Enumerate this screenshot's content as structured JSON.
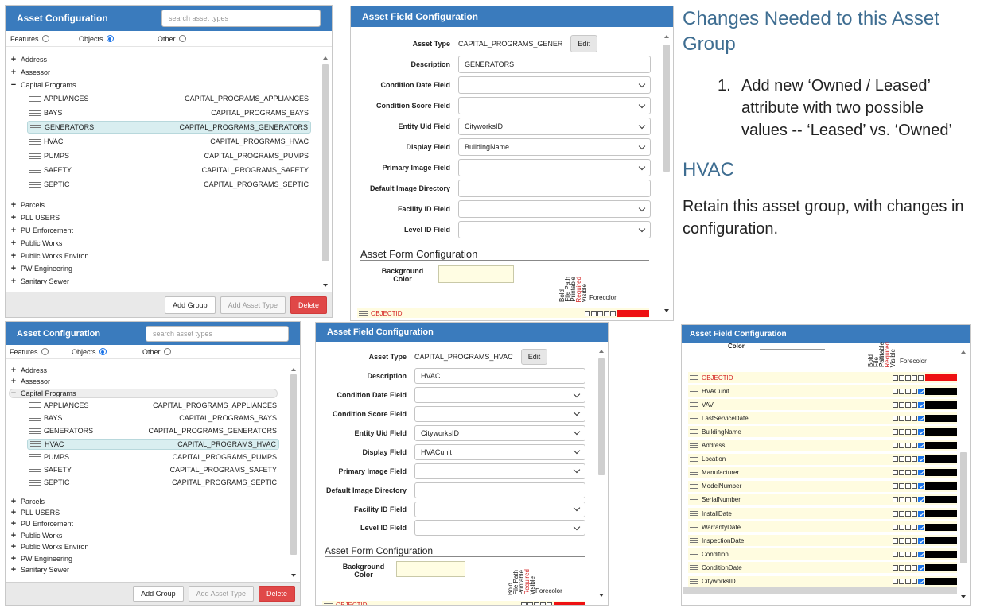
{
  "asset_config": {
    "title": "Asset Configuration",
    "search_placeholder": "search asset types",
    "radios": [
      {
        "label": "Features",
        "checked": false
      },
      {
        "label": "Objects",
        "checked": true
      },
      {
        "label": "Other",
        "checked": false
      }
    ],
    "top_nodes": [
      {
        "sign": "+",
        "label": "Address"
      },
      {
        "sign": "+",
        "label": "Assessor"
      },
      {
        "sign": "−",
        "label": "Capital Programs"
      }
    ],
    "leaves": [
      {
        "name": "APPLIANCES",
        "code": "CAPITAL_PROGRAMS_APPLIANCES"
      },
      {
        "name": "BAYS",
        "code": "CAPITAL_PROGRAMS_BAYS"
      },
      {
        "name": "GENERATORS",
        "code": "CAPITAL_PROGRAMS_GENERATORS"
      },
      {
        "name": "HVAC",
        "code": "CAPITAL_PROGRAMS_HVAC"
      },
      {
        "name": "PUMPS",
        "code": "CAPITAL_PROGRAMS_PUMPS"
      },
      {
        "name": "SAFETY",
        "code": "CAPITAL_PROGRAMS_SAFETY"
      },
      {
        "name": "SEPTIC",
        "code": "CAPITAL_PROGRAMS_SEPTIC"
      }
    ],
    "bottom_nodes": [
      {
        "sign": "+",
        "label": "Parcels"
      },
      {
        "sign": "+",
        "label": "PLL USERS"
      },
      {
        "sign": "+",
        "label": "PU Enforcement"
      },
      {
        "sign": "+",
        "label": "Public Works"
      },
      {
        "sign": "+",
        "label": "Public Works Environ"
      },
      {
        "sign": "+",
        "label": "PW Engineering"
      },
      {
        "sign": "+",
        "label": "Sanitary Sewer"
      }
    ],
    "buttons": {
      "add_group": "Add Group",
      "add_asset_type": "Add Asset Type",
      "delete": "Delete"
    }
  },
  "field_config_labels": {
    "title": "Asset Field Configuration",
    "asset_type": "Asset Type",
    "edit": "Edit",
    "description": "Description",
    "condition_date": "Condition Date Field",
    "condition_score": "Condition Score Field",
    "entity_uid": "Entity Uid Field",
    "display": "Display Field",
    "primary_image": "Primary Image Field",
    "default_image_dir": "Default Image Directory",
    "facility_id": "Facility ID Field",
    "level_id": "Level ID Field",
    "form_title": "Asset Form Configuration",
    "bg_color": "Background Color",
    "col_bold": "Bold",
    "col_filepath": "File Path",
    "col_printable": "Printable",
    "col_required": "Required",
    "col_visible": "Visible",
    "col_forecolor": "Forecolor",
    "partial_first_field": "OBJECTID"
  },
  "generators": {
    "selected": "GENERATORS",
    "asset_type_value": "CAPITAL_PROGRAMS_GENER",
    "description_value": "GENERATORS",
    "entity_uid_value": "CityworksID",
    "display_value": "BuildingName"
  },
  "hvac": {
    "selected": "HVAC",
    "asset_type_value": "CAPITAL_PROGRAMS_HVAC",
    "description_value": "HVAC",
    "entity_uid_value": "CityworksID",
    "display_value": "HVACunit"
  },
  "hvac_fields": {
    "title": "Asset Field Configuration",
    "color_label": "Color",
    "col_bold": "Bold",
    "col_filepath": "File Path",
    "col_printable": "Printable",
    "col_required": "Required",
    "col_visible": "Visible",
    "col_forecolor": "Forecolor",
    "rows": [
      {
        "name": "OBJECTID",
        "red": true,
        "visible": false,
        "color": "#ee1111"
      },
      {
        "name": "HVACunit",
        "red": false,
        "visible": true,
        "color": "#000000"
      },
      {
        "name": "VAV",
        "red": false,
        "visible": true,
        "color": "#000000"
      },
      {
        "name": "LastServiceDate",
        "red": false,
        "visible": true,
        "color": "#000000"
      },
      {
        "name": "BuildingName",
        "red": false,
        "visible": true,
        "color": "#000000"
      },
      {
        "name": "Address",
        "red": false,
        "visible": true,
        "color": "#000000"
      },
      {
        "name": "Location",
        "red": false,
        "visible": true,
        "color": "#000000"
      },
      {
        "name": "Manufacturer",
        "red": false,
        "visible": true,
        "color": "#000000"
      },
      {
        "name": "ModelNumber",
        "red": false,
        "visible": true,
        "color": "#000000"
      },
      {
        "name": "SerialNumber",
        "red": false,
        "visible": true,
        "color": "#000000"
      },
      {
        "name": "InstallDate",
        "red": false,
        "visible": true,
        "color": "#000000"
      },
      {
        "name": "WarrantyDate",
        "red": false,
        "visible": true,
        "color": "#000000"
      },
      {
        "name": "InspectionDate",
        "red": false,
        "visible": true,
        "color": "#000000"
      },
      {
        "name": "Condition",
        "red": false,
        "visible": true,
        "color": "#000000"
      },
      {
        "name": "ConditionDate",
        "red": false,
        "visible": true,
        "color": "#000000"
      },
      {
        "name": "CityworksID",
        "red": false,
        "visible": true,
        "color": "#000000"
      }
    ]
  },
  "notes": {
    "heading1": "Changes Needed to this Asset Group",
    "item_number": "1.",
    "item_text": "Add new ‘Owned / Leased’ attribute with two possible values -- ‘Leased’ vs. ‘Owned’",
    "heading2": "HVAC",
    "paragraph": "Retain this asset group, with changes in configuration."
  },
  "colors": {
    "header_blue": "#3a7bbd",
    "selection": "#d9eef0",
    "delete_red": "#e04848",
    "heading_blue": "#3e6d91",
    "required_red": "#d32020"
  }
}
